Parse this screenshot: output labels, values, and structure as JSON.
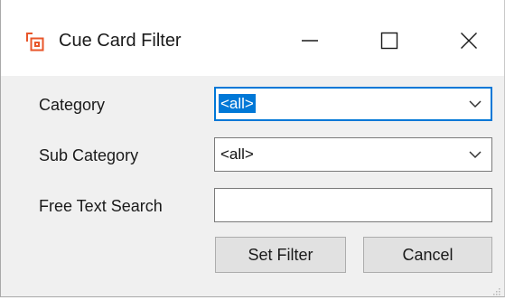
{
  "window": {
    "title": "Cue Card Filter",
    "app_icon": "cue-card-icon",
    "accent_color": "#e8562a",
    "caption_buttons": {
      "minimize_icon": "minimize-icon",
      "maximize_icon": "maximize-icon",
      "close_icon": "close-icon"
    }
  },
  "form": {
    "category": {
      "label": "Category",
      "value": "<all>",
      "focused": true
    },
    "sub_category": {
      "label": "Sub Category",
      "value": "<all>"
    },
    "free_text": {
      "label": "Free Text Search",
      "value": "",
      "placeholder": ""
    }
  },
  "buttons": {
    "set_filter": "Set Filter",
    "cancel": "Cancel"
  },
  "colors": {
    "focus": "#0078d7",
    "dialog_bg": "#f0f0f0",
    "button_bg": "#e1e1e1"
  }
}
